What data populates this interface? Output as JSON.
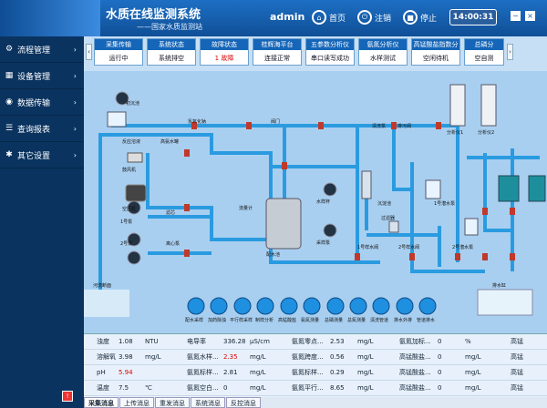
{
  "header": {
    "title": "水质在线监测系统",
    "subtitle": "——国家水质监测站",
    "user": "admin",
    "home": "首页",
    "logout": "注销",
    "stop": "停止",
    "clock": "14:00:31"
  },
  "sidebar": [
    {
      "label": "流程管理",
      "icon": "flow-icon"
    },
    {
      "label": "设备管理",
      "icon": "device-icon"
    },
    {
      "label": "数据传输",
      "icon": "transfer-icon"
    },
    {
      "label": "查询报表",
      "icon": "report-icon"
    },
    {
      "label": "其它设置",
      "icon": "settings-icon"
    }
  ],
  "cards": [
    {
      "title": "采集传输",
      "value": "运行中"
    },
    {
      "title": "系统状态",
      "value": "系统排空"
    },
    {
      "title": "故障状态",
      "value": "1 故障",
      "alert": true
    },
    {
      "title": "桂辉海平台",
      "value": "连接正常"
    },
    {
      "title": "五参数分析仪",
      "value": "串口读写成功"
    },
    {
      "title": "氨氮分析仪",
      "value": "水样测试"
    },
    {
      "title": "高锰酸盐指数分析仪",
      "value": "空闲待机"
    },
    {
      "title": "总磷分",
      "value": "空自测"
    }
  ],
  "diagram": {
    "labels": [
      "初沉池",
      "反应溶液",
      "高氨水罐",
      "氢氧化钠",
      "鼓风机",
      "空压机",
      "1号泵",
      "2号泵",
      "离心泵",
      "滤芯",
      "阀门",
      "流量计",
      "配水池",
      "水样杯",
      "采样泵",
      "清洗泵",
      "排污阀",
      "1号样水阀",
      "2号样水阀",
      "过滤器",
      "沉淀池",
      "1号潜水泵",
      "2号潜水泵",
      "分析仪1",
      "分析仪2"
    ],
    "buttons": [
      "配水采样",
      "加药除浊",
      "平行样采样",
      "制样分析",
      "高锰酸盐",
      "氨氮测量",
      "总磷测量",
      "总氮测量",
      "清洗管道",
      "排水外排",
      "管道排水"
    ],
    "pit_label": "河流断面",
    "tank_label": "排水缸"
  },
  "data_rows": [
    [
      "浊度",
      "1.08",
      "NTU",
      "电导率",
      "336.28",
      "μS/cm",
      "氨氮零点...",
      "2.53",
      "mg/L",
      "氨氮加标...",
      "0",
      "%",
      "高锰"
    ],
    [
      "溶解氧",
      "3.98",
      "mg/L",
      "氨氮水样...",
      "2.35",
      "mg/L",
      "氨氮跨度...",
      "0.56",
      "mg/L",
      "高锰酸盐...",
      "0",
      "mg/L",
      "高锰"
    ],
    [
      "pH",
      "5.94",
      "",
      "氨氮标样...",
      "2.81",
      "mg/L",
      "氨氮标样...",
      "0.29",
      "mg/L",
      "高锰酸盐...",
      "0",
      "mg/L",
      "高锰"
    ],
    [
      "温度",
      "7.5",
      "℃",
      "氨氮空白...",
      "0",
      "mg/L",
      "氨氮平行...",
      "8.65",
      "mg/L",
      "高锰酸盐...",
      "0",
      "mg/L",
      "高锰"
    ]
  ],
  "tabs": [
    "采集消息",
    "上传消息",
    "重发消息",
    "系统消息",
    "反控消息"
  ],
  "colors": {
    "pipe": "#2a9be0",
    "valve": "#c0392b",
    "accent": "#1565b8"
  }
}
